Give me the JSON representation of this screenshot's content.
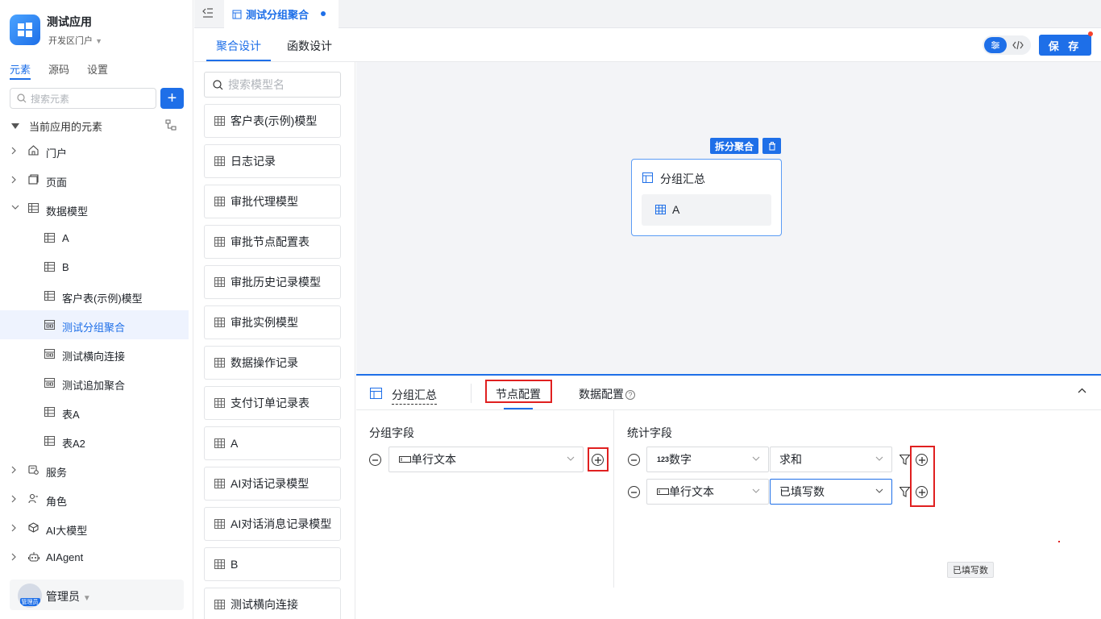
{
  "app": {
    "name": "测试应用",
    "portal": "开发区门户"
  },
  "sidebar": {
    "tabs": [
      "元素",
      "源码",
      "设置"
    ],
    "search_placeholder": "搜索元素",
    "add_label": "+",
    "root_label": "当前应用的元素",
    "items": [
      {
        "label": "门户",
        "icon": "home-icon",
        "level": 0,
        "expandable": true
      },
      {
        "label": "页面",
        "icon": "page-icon",
        "level": 0,
        "expandable": true
      },
      {
        "label": "数据模型",
        "icon": "table-icon",
        "level": 0,
        "expandable": true,
        "expanded": true
      },
      {
        "label": "A",
        "icon": "table-icon",
        "level": 1
      },
      {
        "label": "B",
        "icon": "table-icon",
        "level": 1
      },
      {
        "label": "客户表(示例)模型",
        "icon": "table-icon",
        "level": 1
      },
      {
        "label": "测试分组聚合",
        "icon": "aggregate-icon",
        "level": 1,
        "selected": true
      },
      {
        "label": "测试横向连接",
        "icon": "aggregate-icon",
        "level": 1
      },
      {
        "label": "测试追加聚合",
        "icon": "aggregate-icon",
        "level": 1
      },
      {
        "label": "表A",
        "icon": "table-icon",
        "level": 1
      },
      {
        "label": "表A2",
        "icon": "table-icon",
        "level": 1
      },
      {
        "label": "服务",
        "icon": "service-icon",
        "level": 0,
        "expandable": true
      },
      {
        "label": "角色",
        "icon": "role-icon",
        "level": 0,
        "expandable": true
      },
      {
        "label": "AI大模型",
        "icon": "ai-model-icon",
        "level": 0,
        "expandable": true
      },
      {
        "label": "AIAgent",
        "icon": "robot-icon",
        "level": 0,
        "expandable": true
      }
    ],
    "user": {
      "name": "管理员",
      "avatar_label": "管理员"
    }
  },
  "doc_tab": {
    "label": "测试分组聚合"
  },
  "header_tabs": [
    "聚合设计",
    "函数设计"
  ],
  "save_label": "保 存",
  "model_list": {
    "search_placeholder": "搜索模型名",
    "items": [
      "客户表(示例)模型",
      "日志记录",
      "审批代理模型",
      "审批节点配置表",
      "审批历史记录模型",
      "审批实例模型",
      "数据操作记录",
      "支付订单记录表",
      "A",
      "AI对话记录模型",
      "AI对话消息记录模型",
      "B",
      "测试横向连接"
    ]
  },
  "canvas": {
    "split_label": "拆分聚合",
    "node": {
      "title": "分组汇总",
      "item": "A"
    }
  },
  "panel": {
    "title": "分组汇总",
    "tabs": [
      "节点配置",
      "数据配置"
    ],
    "group_section": "分组字段",
    "group_fields": [
      {
        "label": "单行文本",
        "type_icon": "text-field-icon"
      }
    ],
    "stat_section": "统计字段",
    "stat_fields": [
      {
        "label": "数字",
        "type_icon": "number-field-icon",
        "type_prefix": "123",
        "agg": "求和"
      },
      {
        "label": "单行文本",
        "type_icon": "text-field-icon",
        "agg": "已填写数"
      }
    ],
    "tooltip": "已填写数"
  }
}
